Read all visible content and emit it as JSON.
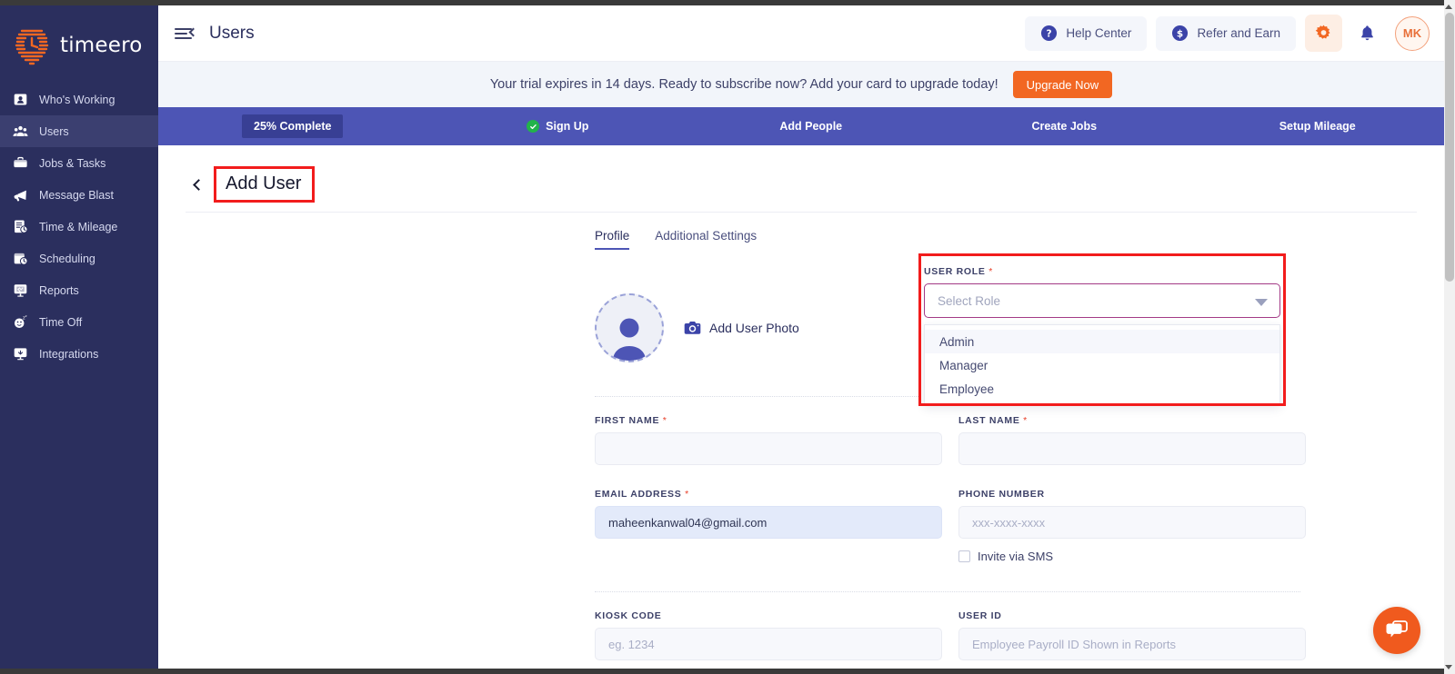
{
  "brand": {
    "name": "timeero",
    "accent": "#f26722",
    "sidebar_bg": "#2b2f5e"
  },
  "sidebar": {
    "items": [
      {
        "label": "Who's Working",
        "icon": "whos-working-icon",
        "active": false
      },
      {
        "label": "Users",
        "icon": "users-icon",
        "active": true
      },
      {
        "label": "Jobs & Tasks",
        "icon": "briefcase-icon",
        "active": false
      },
      {
        "label": "Message Blast",
        "icon": "megaphone-icon",
        "active": false
      },
      {
        "label": "Time & Mileage",
        "icon": "time-mileage-icon",
        "active": false
      },
      {
        "label": "Scheduling",
        "icon": "calendar-clock-icon",
        "active": false
      },
      {
        "label": "Reports",
        "icon": "reports-icon",
        "active": false
      },
      {
        "label": "Time Off",
        "icon": "time-off-icon",
        "active": false
      },
      {
        "label": "Integrations",
        "icon": "integrations-icon",
        "active": false
      }
    ]
  },
  "topbar": {
    "title": "Users",
    "help_center": "Help Center",
    "refer_and_earn": "Refer and Earn",
    "avatar_initials": "MK"
  },
  "trial": {
    "message": "Your trial expires in 14 days. Ready to subscribe now? Add your card to upgrade today!",
    "upgrade_label": "Upgrade Now"
  },
  "progress": {
    "percent_label": "25% Complete",
    "steps": [
      {
        "label": "Sign Up",
        "completed": true
      },
      {
        "label": "Add People",
        "completed": false
      },
      {
        "label": "Create Jobs",
        "completed": false
      },
      {
        "label": "Setup Mileage",
        "completed": false
      }
    ]
  },
  "page": {
    "heading": "Add User",
    "tabs": [
      {
        "label": "Profile",
        "active": true
      },
      {
        "label": "Additional Settings",
        "active": false
      }
    ]
  },
  "form": {
    "photo": {
      "add_photo_label": "Add User Photo"
    },
    "user_role": {
      "label": "USER ROLE",
      "required": "*",
      "placeholder": "Select Role",
      "value": "",
      "options": [
        "Admin",
        "Manager",
        "Employee"
      ],
      "highlighted_option": "Admin",
      "open": true
    },
    "first_name": {
      "label": "FIRST NAME",
      "required": "*",
      "value": "",
      "placeholder": ""
    },
    "last_name": {
      "label": "LAST NAME",
      "required": "*",
      "value": "",
      "placeholder": ""
    },
    "email_address": {
      "label": "EMAIL ADDRESS",
      "required": "*",
      "value": "maheenkanwal04@gmail.com",
      "placeholder": ""
    },
    "phone_number": {
      "label": "PHONE NUMBER",
      "required": "",
      "value": "",
      "placeholder": "xxx-xxxx-xxxx"
    },
    "invite_via_sms": {
      "label": "Invite via SMS",
      "checked": false
    },
    "kiosk_code": {
      "label": "KIOSK CODE",
      "required": "",
      "value": "",
      "placeholder": "eg. 1234"
    },
    "user_id": {
      "label": "USER ID",
      "required": "",
      "value": "",
      "placeholder": "Employee Payroll ID Shown in Reports"
    }
  },
  "chat": {
    "label": "chat-bubble-icon"
  }
}
